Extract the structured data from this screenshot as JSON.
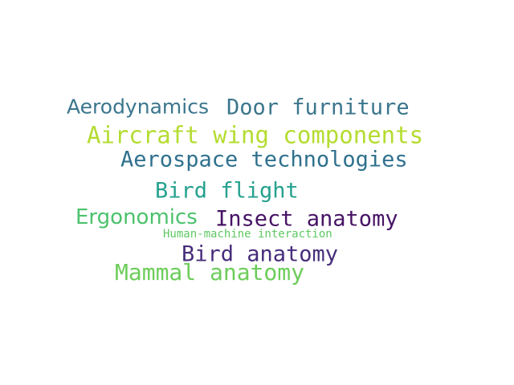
{
  "words": [
    {
      "text": "Aerodynamics",
      "color": "#3b768d"
    },
    {
      "text": "Door furniture",
      "color": "#3b768d"
    },
    {
      "text": "Aircraft wing components",
      "color": "#b4dc30"
    },
    {
      "text": "Aerospace technologies",
      "color": "#2f718e"
    },
    {
      "text": "Bird flight",
      "color": "#25a18e"
    },
    {
      "text": "Ergonomics",
      "color": "#4cc26c"
    },
    {
      "text": "Insect anatomy",
      "color": "#471365"
    },
    {
      "text": "Human-machine interaction",
      "color": "#5ec962"
    },
    {
      "text": "Bird anatomy",
      "color": "#472d7b"
    },
    {
      "text": "Mammal anatomy",
      "color": "#6ccd5a"
    }
  ]
}
